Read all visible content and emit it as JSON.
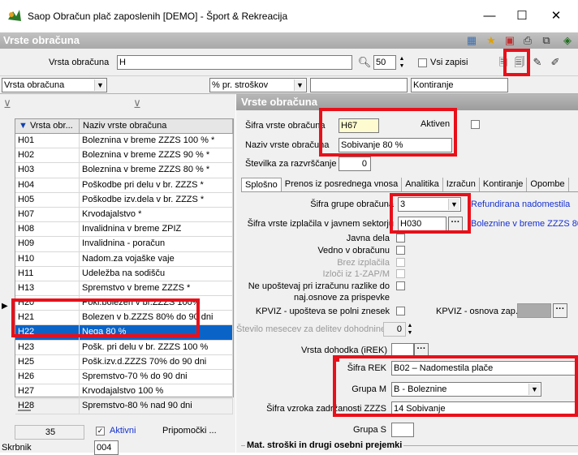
{
  "window": {
    "title": "Saop Obračun plač zaposlenih [DEMO] - Šport & Rekreacija",
    "minimize": "—",
    "maximize": "☐",
    "close": "✕"
  },
  "header": {
    "title": "Vrste obračuna"
  },
  "search": {
    "label": "Vrsta obračuna",
    "value": "H",
    "count": "50",
    "all_label": "Vsi zapisi"
  },
  "filters": {
    "f1": "Vrsta obračuna",
    "f2": "% pr. stroškov",
    "f3": "",
    "f4": "Kontiranje"
  },
  "grid": {
    "col1": "Vrsta obr...",
    "col2": "Naziv vrste obračuna",
    "rows": [
      {
        "code": "H01",
        "name": "Boleznina v breme ZZZS 100 % *"
      },
      {
        "code": "H02",
        "name": "Boleznina v breme ZZZS 90 % *"
      },
      {
        "code": "H03",
        "name": "Boleznina v breme ZZZS 80 % *"
      },
      {
        "code": "H04",
        "name": "Poškodbe pri delu v br. ZZZS *"
      },
      {
        "code": "H05",
        "name": "Poškodbe izv.dela v br. ZZZS *"
      },
      {
        "code": "H07",
        "name": "Krvodajalstvo *"
      },
      {
        "code": "H08",
        "name": "Invalidnina v breme ZPIZ"
      },
      {
        "code": "H09",
        "name": "Invalidnina - poračun"
      },
      {
        "code": "H10",
        "name": "Nadom.za vojaške vaje"
      },
      {
        "code": "H11",
        "name": "Udeležba na sodišču"
      },
      {
        "code": "H13",
        "name": "Spremstvo v breme ZZZS *"
      },
      {
        "code": "H20",
        "name": "Pokl.bolezen v br.ZZZS 100%"
      },
      {
        "code": "H21",
        "name": "Bolezen v b.ZZZS 80% do 90 dni"
      },
      {
        "code": "H22",
        "name": "Nega 80 %"
      },
      {
        "code": "H23",
        "name": "Pošk. pri delu v br. ZZZS 100 %"
      },
      {
        "code": "H25",
        "name": "Pošk.izv.d.ZZZS 70% do 90 dni"
      },
      {
        "code": "H26",
        "name": "Spremstvo-70 % do 90 dni"
      },
      {
        "code": "H27",
        "name": "Krvodajalstvo 100 %"
      },
      {
        "code": "H28",
        "name": "Spremstvo-80 % nad 90 dni"
      }
    ]
  },
  "footer": {
    "count": "35",
    "active_label": "Aktivni",
    "tools_label": "Pripomočki ...",
    "skrbnik_label": "Skrbnik",
    "skrbnik_value": "004"
  },
  "detail": {
    "header": "Vrste obračuna",
    "sifra_label": "Šifra vrste obračuna",
    "sifra_value": "H67",
    "aktiven_label": "Aktiven",
    "naziv_label": "Naziv vrste obračuna",
    "naziv_value": "Sobivanje 80 %",
    "stevilka_label": "Številka za razvrščanje",
    "stevilka_value": "0",
    "tabs": [
      "Splošno",
      "Prenos iz posrednega vnosa",
      "Analitika",
      "Izračun",
      "Kontiranje",
      "Opombe"
    ],
    "grupa_label": "Šifra grupe obračuna",
    "grupa_value": "3",
    "grupa_link": "Refundirana nadomestila",
    "izplacila_label": "Šifra vrste izplačila v javnem sektorju",
    "izplacila_value": "H030",
    "izplacila_link": "Boleznine v breme ZZZS 80",
    "javna_dela": "Javna dela",
    "vedno": "Vedno v obračunu",
    "brez": "Brez izplačila",
    "izloci": "Izloči iz 1-ZAP/M",
    "neupostevaj1": "Ne upoštevaj pri izračunu razlike do",
    "neupostevaj2": "naj.osnove za prispevke",
    "kpviz1": "KPVIZ - upošteva se polni znesek",
    "kpviz2": "KPVIZ - osnova zap.",
    "stevilo_mesecev": "Število mesecev za delitev dohodnine:",
    "stevilo_value": "0",
    "vrsta_dohodka": "Vrsta dohodka (iREK)",
    "sifra_rek_label": "Šifra REK",
    "sifra_rek_value": "B02 – Nadomestila plače",
    "grupa_m_label": "Grupa M",
    "grupa_m_value": "B - Boleznine",
    "vzrok_label": "Šifra vzroka zadržanosti ZZZS",
    "vzrok_value": "14 Sobivanje",
    "grupa_s_label": "Grupa S",
    "mat_stroski": "Mat. stroški in drugi osebni prejemki"
  },
  "colors": {
    "selection": "#0a64c8",
    "highlight": "#e8101a",
    "link": "#1530d0"
  }
}
